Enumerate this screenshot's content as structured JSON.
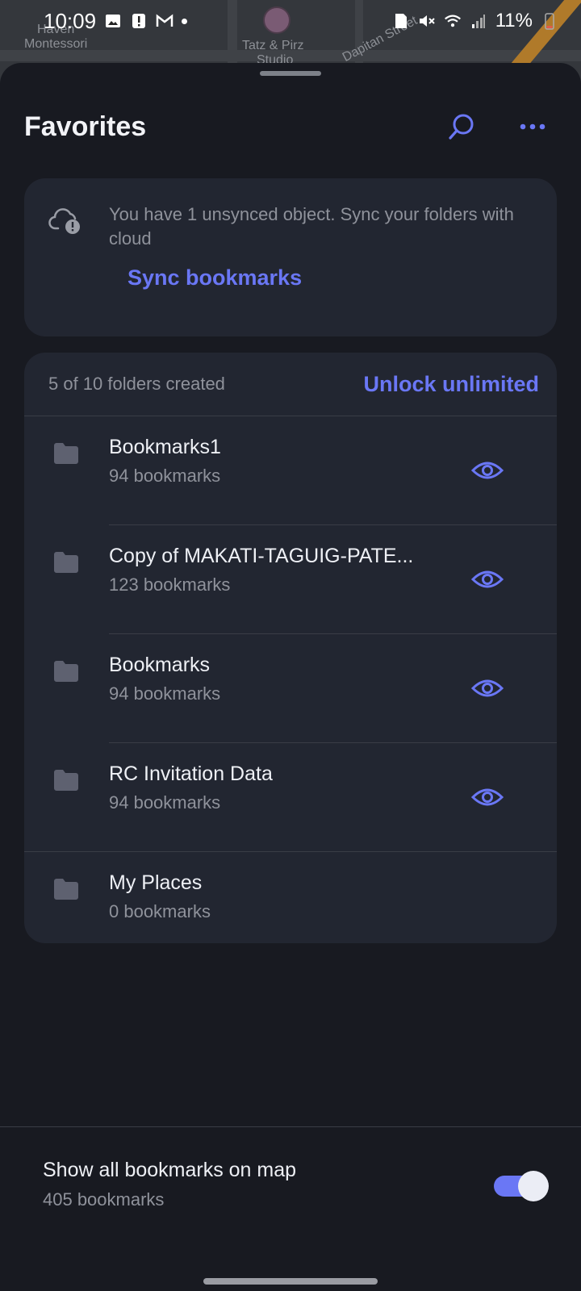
{
  "status_bar": {
    "time": "10:09",
    "battery": "11%",
    "left_icons": [
      "gallery-icon",
      "alert-icon",
      "gmail-icon",
      "dot-icon"
    ],
    "right_icons": [
      "sim-icon",
      "mute-icon",
      "wifi-icon",
      "signal-icon",
      "battery-icon"
    ]
  },
  "map": {
    "labels": [
      "Haven",
      "Montessori",
      "Tatz & Pirz",
      "Studio",
      "Dapitan Street"
    ]
  },
  "header": {
    "title": "Favorites",
    "search_icon": "search-icon",
    "more_icon": "more-horizontal-icon"
  },
  "sync_card": {
    "message": "You have 1 unsynced object. Sync your folders with cloud",
    "button_label": "Sync bookmarks",
    "icon": "cloud-warning-icon"
  },
  "folders": {
    "count_text": "5 of 10 folders created",
    "unlock_label": "Unlock unlimited",
    "items": [
      {
        "name": "Bookmarks1",
        "count": "94 bookmarks",
        "visible": true
      },
      {
        "name": "Copy of MAKATI-TAGUIG-PATE...",
        "count": "123 bookmarks",
        "visible": true
      },
      {
        "name": "Bookmarks",
        "count": "94 bookmarks",
        "visible": true
      },
      {
        "name": "RC Invitation Data",
        "count": "94 bookmarks",
        "visible": true
      },
      {
        "name": "My Places",
        "count": "0 bookmarks",
        "visible": false
      }
    ]
  },
  "footer": {
    "title": "Show all bookmarks on map",
    "count": "405 bookmarks",
    "toggle_on": true
  },
  "colors": {
    "accent": "#6a77f5",
    "sheet_bg": "#181a21",
    "card_bg": "#222631",
    "secondary_text": "#8f929b"
  }
}
